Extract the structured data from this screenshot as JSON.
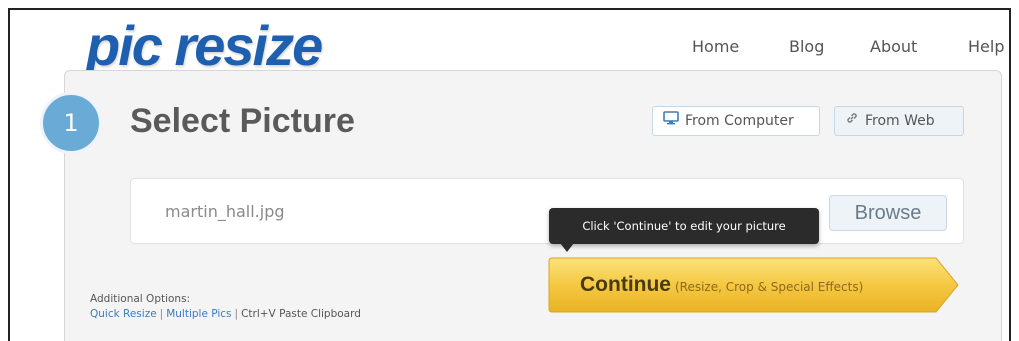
{
  "header": {
    "logo_text": "pic resize",
    "nav": [
      {
        "label": "Home"
      },
      {
        "label": "Blog"
      },
      {
        "label": "About"
      },
      {
        "label": "Help"
      }
    ]
  },
  "step": {
    "number": "1",
    "title": "Select Picture"
  },
  "source_buttons": {
    "computer_label": "From Computer",
    "computer_icon": "monitor-icon",
    "web_label": "From Web",
    "web_icon": "link-icon"
  },
  "file": {
    "name": "martin_hall.jpg",
    "browse_label": "Browse"
  },
  "tooltip": {
    "text": "Click 'Continue' to edit your picture"
  },
  "continue_button": {
    "label": "Continue",
    "sublabel": "(Resize, Crop & Special Effects)"
  },
  "additional_options": {
    "heading": "Additional Options:",
    "quick_resize": "Quick Resize",
    "multiple_pics": "Multiple Pics",
    "paste_clipboard": "Ctrl+V Paste Clipboard",
    "separator": "|"
  },
  "colors": {
    "logo": "#1f5fb0",
    "step_circle": "#6aaad6",
    "continue_button": "#f5c842",
    "link": "#3a7cc0"
  }
}
